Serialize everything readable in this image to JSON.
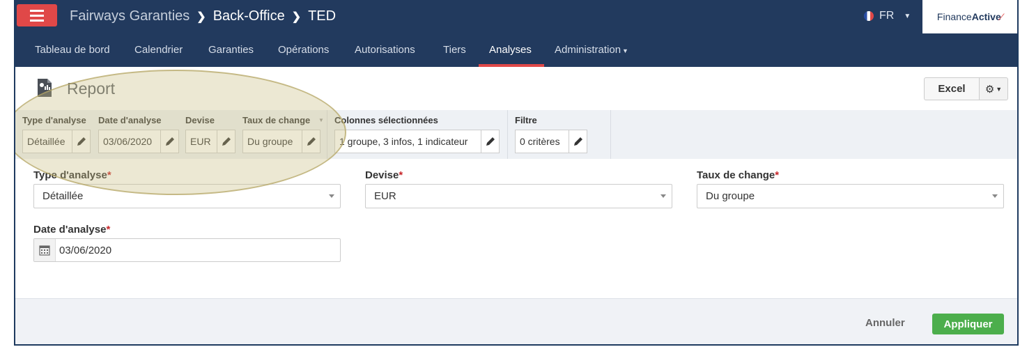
{
  "header": {
    "app_name": "Fairways Garanties",
    "crumb_1": "Back-Office",
    "crumb_2": "TED",
    "language": "FR",
    "brand_part1": "Finance",
    "brand_part2": "Active"
  },
  "nav": {
    "items": [
      {
        "label": "Tableau de bord"
      },
      {
        "label": "Calendrier"
      },
      {
        "label": "Garanties"
      },
      {
        "label": "Opérations"
      },
      {
        "label": "Autorisations"
      },
      {
        "label": "Tiers"
      },
      {
        "label": "Analyses",
        "active": true
      },
      {
        "label": "Administration"
      }
    ]
  },
  "page": {
    "title": "Report",
    "excel_label": "Excel"
  },
  "summary": {
    "type_label": "Type d'analyse",
    "type_value": "Détaillée",
    "date_label": "Date d'analyse",
    "date_value": "03/06/2020",
    "devise_label": "Devise",
    "devise_value": "EUR",
    "taux_label": "Taux de change",
    "taux_value": "Du groupe",
    "colonnes_label": "Colonnes sélectionnées",
    "colonnes_value": "1 groupe, 3 infos, 1 indicateur",
    "filtre_label": "Filtre",
    "filtre_value": "0 critères"
  },
  "form": {
    "type_label": "Type d'analyse",
    "type_value": "Détaillée",
    "devise_label": "Devise",
    "devise_value": "EUR",
    "taux_label": "Taux de change",
    "taux_value": "Du groupe",
    "date_label": "Date d'analyse",
    "date_value": "03/06/2020",
    "required_mark": "*"
  },
  "footer": {
    "cancel_label": "Annuler",
    "apply_label": "Appliquer"
  },
  "colors": {
    "navy": "#223a5e",
    "accent_red": "#e04848",
    "apply_green": "#4cae4c",
    "required_red": "#c8272b"
  }
}
